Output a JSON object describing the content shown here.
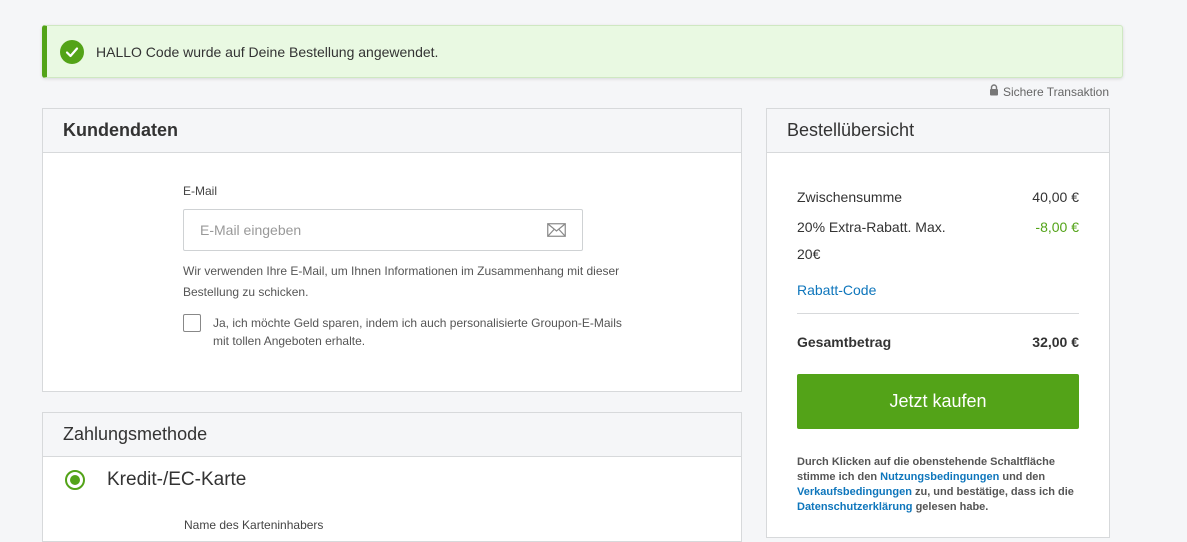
{
  "alert": {
    "message": "HALLO Code wurde auf Deine Bestellung angewendet.",
    "icon": "check-circle-icon",
    "accent": "#53a318"
  },
  "secure": {
    "label": "Sichere Transaktion",
    "icon": "lock-icon"
  },
  "customer": {
    "title": "Kundendaten",
    "email_label": "E-Mail",
    "email_placeholder": "E-Mail eingeben",
    "email_value": "",
    "email_hint": "Wir verwenden Ihre E-Mail, um Ihnen Informationen im Zusammenhang mit dieser Bestellung zu schicken.",
    "optin_label": "Ja, ich möchte Geld sparen, indem ich auch personalisierte Groupon-E-Mails mit tollen Angeboten erhalte.",
    "optin_checked": false
  },
  "payment": {
    "title": "Zahlungsmethode",
    "method_label": "Kredit-/EC-Karte",
    "selected": true,
    "cardholder_label": "Name des Karteninhabers"
  },
  "summary": {
    "title": "Bestellübersicht",
    "subtotal_label": "Zwischensumme",
    "subtotal_value": "40,00 €",
    "discount_label": "20% Extra-Rabatt. Max. 20€",
    "discount_value": "-8,00 €",
    "promo_link": "Rabatt-Code",
    "total_label": "Gesamtbetrag",
    "total_value": "32,00 €",
    "buy_button": "Jetzt kaufen",
    "terms": {
      "t1": "Durch Klicken auf die obenstehende Schaltfläche stimme ich den ",
      "link1": "Nutzungsbedingungen",
      "t2": " und den ",
      "link2": "Verkaufsbedingungen",
      "t3": " zu, und bestätige, dass ich die ",
      "link3": "Datenschutzerklärung",
      "t4": " gelesen habe."
    }
  },
  "colors": {
    "primary": "#53a318",
    "link": "#0e76bc"
  }
}
